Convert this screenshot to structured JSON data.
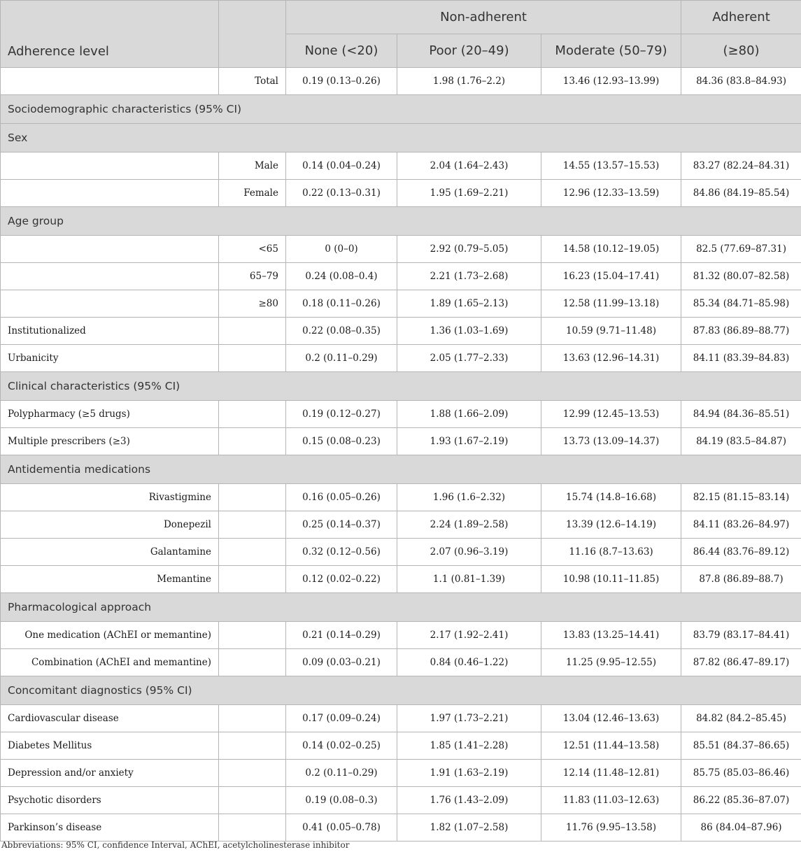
{
  "header": {
    "adherence_level": "Adherence level",
    "non_adherent": "Non-adherent",
    "adherent": "Adherent",
    "none": "None (<20)",
    "poor": "Poor (20–49)",
    "moderate": "Moderate (50–79)",
    "adherent_range": "(≥80)"
  },
  "rows": [
    {
      "type": "data",
      "label": "",
      "sub": "Total",
      "v": [
        "0.19 (0.13–0.26)",
        "1.98 (1.76–2.2)",
        "13.46 (12.93–13.99)",
        "84.36 (83.8–84.93)"
      ]
    },
    {
      "type": "section",
      "title": "Sociodemographic characteristics (95% CI)"
    },
    {
      "type": "section",
      "title": "Sex"
    },
    {
      "type": "data",
      "label": "",
      "sub": "Male",
      "v": [
        "0.14 (0.04–0.24)",
        "2.04 (1.64–2.43)",
        "14.55 (13.57–15.53)",
        "83.27 (82.24–84.31)"
      ]
    },
    {
      "type": "data",
      "label": "",
      "sub": "Female",
      "v": [
        "0.22 (0.13–0.31)",
        "1.95 (1.69–2.21)",
        "12.96 (12.33–13.59)",
        "84.86 (84.19–85.54)"
      ]
    },
    {
      "type": "section",
      "title": "Age group"
    },
    {
      "type": "data",
      "label": "",
      "sub": "<65",
      "v": [
        "0 (0–0)",
        "2.92 (0.79–5.05)",
        "14.58 (10.12–19.05)",
        "82.5 (77.69–87.31)"
      ]
    },
    {
      "type": "data",
      "label": "",
      "sub": "65–79",
      "v": [
        "0.24 (0.08–0.4)",
        "2.21 (1.73–2.68)",
        "16.23 (15.04–17.41)",
        "81.32 (80.07–82.58)"
      ]
    },
    {
      "type": "data",
      "label": "",
      "sub": "≥80",
      "v": [
        "0.18 (0.11–0.26)",
        "1.89 (1.65–2.13)",
        "12.58 (11.99–13.18)",
        "85.34 (84.71–85.98)"
      ]
    },
    {
      "type": "data",
      "label": "Institutionalized",
      "sub": "",
      "v": [
        "0.22 (0.08–0.35)",
        "1.36 (1.03–1.69)",
        "10.59 (9.71–11.48)",
        "87.83 (86.89–88.77)"
      ]
    },
    {
      "type": "data",
      "label": "Urbanicity",
      "sub": "",
      "v": [
        "0.2 (0.11–0.29)",
        "2.05 (1.77–2.33)",
        "13.63 (12.96–14.31)",
        "84.11 (83.39–84.83)"
      ]
    },
    {
      "type": "section",
      "title": "Clinical characteristics (95% CI)"
    },
    {
      "type": "data",
      "label": "Polypharmacy (≥5 drugs)",
      "sub": "",
      "v": [
        "0.19 (0.12–0.27)",
        "1.88 (1.66–2.09)",
        "12.99 (12.45–13.53)",
        "84.94 (84.36–85.51)"
      ]
    },
    {
      "type": "data",
      "label": "Multiple prescribers (≥3)",
      "sub": "",
      "v": [
        "0.15 (0.08–0.23)",
        "1.93 (1.67–2.19)",
        "13.73 (13.09–14.37)",
        "84.19 (83.5–84.87)"
      ]
    },
    {
      "type": "section",
      "title": "Antidementia medications"
    },
    {
      "type": "data",
      "label": "Rivastigmine",
      "sub": "",
      "align": "right",
      "v": [
        "0.16 (0.05–0.26)",
        "1.96 (1.6–2.32)",
        "15.74 (14.8–16.68)",
        "82.15 (81.15–83.14)"
      ]
    },
    {
      "type": "data",
      "label": "Donepezil",
      "sub": "",
      "align": "right",
      "v": [
        "0.25 (0.14–0.37)",
        "2.24 (1.89–2.58)",
        "13.39 (12.6–14.19)",
        "84.11 (83.26–84.97)"
      ]
    },
    {
      "type": "data",
      "label": "Galantamine",
      "sub": "",
      "align": "right",
      "v": [
        "0.32 (0.12–0.56)",
        "2.07 (0.96–3.19)",
        "11.16 (8.7–13.63)",
        "86.44 (83.76–89.12)"
      ]
    },
    {
      "type": "data",
      "label": "Memantine",
      "sub": "",
      "align": "right",
      "v": [
        "0.12 (0.02–0.22)",
        "1.1 (0.81–1.39)",
        "10.98 (10.11–11.85)",
        "87.8 (86.89–88.7)"
      ]
    },
    {
      "type": "section",
      "title": "Pharmacological approach"
    },
    {
      "type": "data",
      "label": "One medication (AChEI or memantine)",
      "sub": "",
      "align": "right",
      "v": [
        "0.21 (0.14–0.29)",
        "2.17 (1.92–2.41)",
        "13.83 (13.25–14.41)",
        "83.79 (83.17–84.41)"
      ]
    },
    {
      "type": "data",
      "label": "Combination (AChEI and memantine)",
      "sub": "",
      "align": "right",
      "v": [
        "0.09 (0.03–0.21)",
        "0.84 (0.46–1.22)",
        "11.25 (9.95–12.55)",
        "87.82 (86.47–89.17)"
      ]
    },
    {
      "type": "section",
      "title": "Concomitant diagnostics (95% CI)"
    },
    {
      "type": "data",
      "label": "Cardiovascular disease",
      "sub": "",
      "v": [
        "0.17 (0.09–0.24)",
        "1.97 (1.73–2.21)",
        "13.04 (12.46–13.63)",
        "84.82 (84.2–85.45)"
      ]
    },
    {
      "type": "data",
      "label": "Diabetes Mellitus",
      "sub": "",
      "v": [
        "0.14 (0.02–0.25)",
        "1.85 (1.41–2.28)",
        "12.51 (11.44–13.58)",
        "85.51 (84.37–86.65)"
      ]
    },
    {
      "type": "data",
      "label": "Depression and/or anxiety",
      "sub": "",
      "v": [
        "0.2 (0.11–0.29)",
        "1.91 (1.63–2.19)",
        "12.14 (11.48–12.81)",
        "85.75 (85.03–86.46)"
      ]
    },
    {
      "type": "data",
      "label": "Psychotic disorders",
      "sub": "",
      "v": [
        "0.19 (0.08–0.3)",
        "1.76 (1.43–2.09)",
        "11.83 (11.03–12.63)",
        "86.22 (85.36–87.07)"
      ]
    },
    {
      "type": "data",
      "label": "Parkinson’s disease",
      "sub": "",
      "v": [
        "0.41 (0.05–0.78)",
        "1.82 (1.07–2.58)",
        "11.76 (9.95–13.58)",
        "86 (84.04–87.96)"
      ]
    }
  ],
  "footnote": "Abbreviations: 95% CI, confidence Interval, AChEI, acetylcholinesterase inhibitor"
}
